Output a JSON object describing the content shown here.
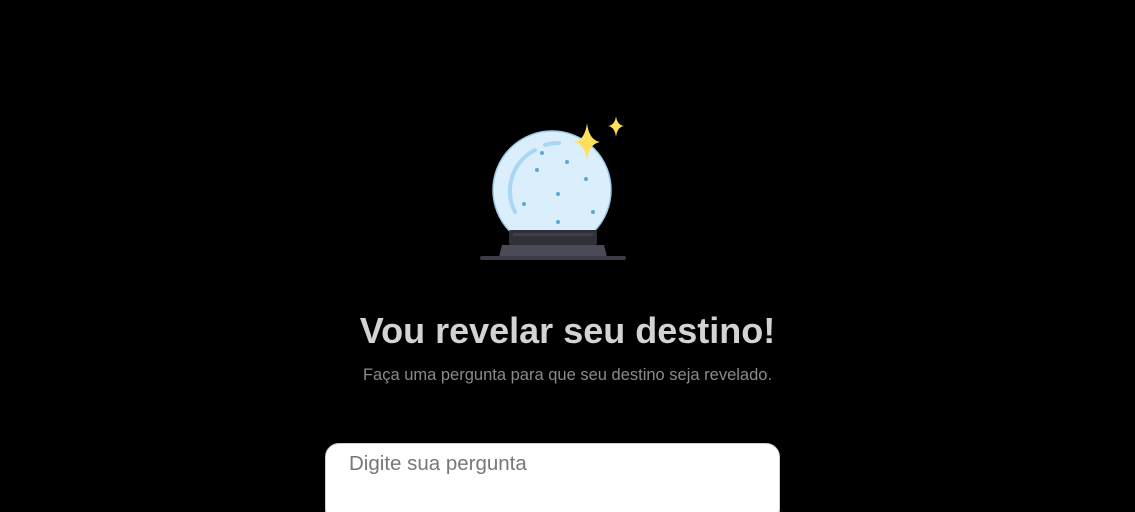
{
  "header": {
    "icon": "crystal-ball-icon",
    "title": "Vou revelar seu destino!",
    "subtitle": "Faça uma pergunta para que seu destino seja revelado."
  },
  "question": {
    "placeholder": "Digite sua pergunta",
    "value": ""
  },
  "colors": {
    "background": "#000000",
    "title": "#d3d3d3",
    "subtitle": "#8a8a8a",
    "ball": "#dbeefb",
    "ball_dots": "#5aa9d6",
    "sparkle": "#ffe05c",
    "base": "#4a4b57"
  }
}
